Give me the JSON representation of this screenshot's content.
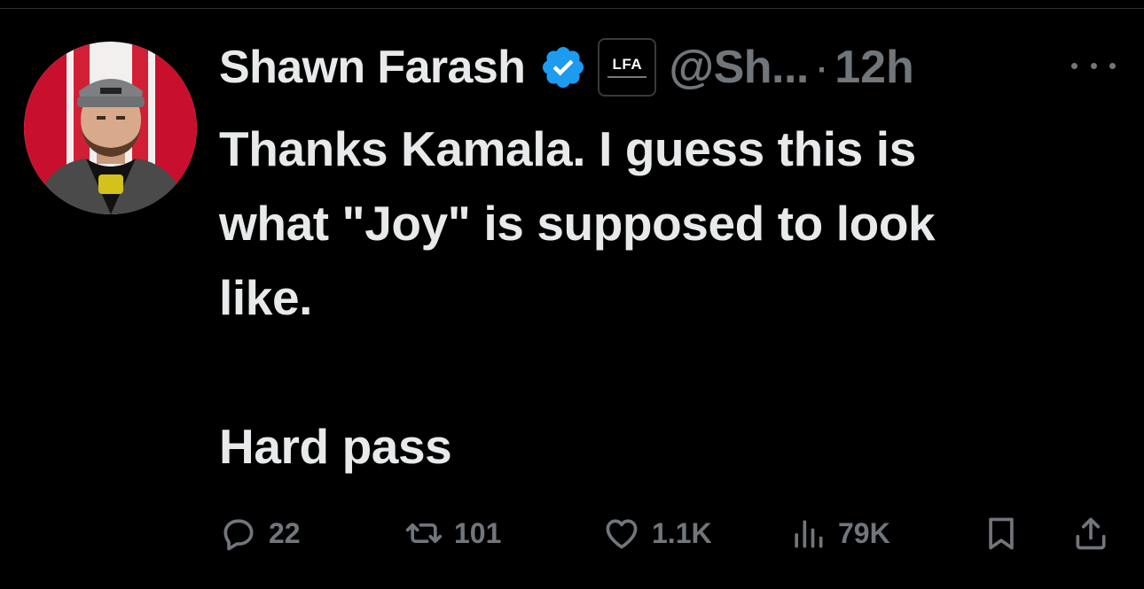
{
  "tweet": {
    "author_name": "Shawn Farash",
    "affiliate_badge_text": "LFA",
    "handle": "@Sh...",
    "separator": "·",
    "time": "12h",
    "text_lines": [
      "Thanks Kamala. I guess this is",
      "what \"Joy\" is supposed to look",
      "like.",
      "Hard pass"
    ]
  },
  "actions": {
    "replies": "22",
    "reposts": "101",
    "likes": "1.1K",
    "views": "79K"
  },
  "icons": {
    "verified": "verified-badge-icon",
    "affiliate": "lfa-affiliate-icon",
    "more": "more-dots-icon",
    "reply": "reply-icon",
    "repost": "repost-icon",
    "like": "heart-icon",
    "views": "views-chart-icon",
    "bookmark": "bookmark-icon",
    "share": "share-icon"
  },
  "colors": {
    "background": "#000000",
    "text_primary": "#e7e9ea",
    "text_secondary": "#71767b",
    "verified_blue": "#1d9bf0"
  }
}
